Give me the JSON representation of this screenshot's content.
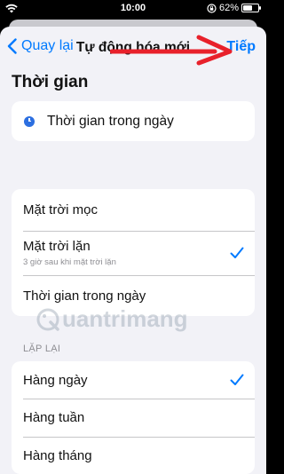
{
  "status_bar": {
    "time": "10:00",
    "battery_text": "62%",
    "battery_level": 0.62,
    "icons": [
      "wifi-icon",
      "screen-lock-icon",
      "battery-icon"
    ]
  },
  "nav": {
    "back_label": "Quay lại",
    "title": "Tự động hóa mới",
    "next_label": "Tiếp",
    "accent_color": "#007aff",
    "annotation_arrow_color": "#e8212b"
  },
  "section_title": "Thời gian",
  "time_of_day": {
    "label": "Thời gian trong ngày",
    "icon": "clock-icon"
  },
  "options": [
    {
      "label": "Mặt trời mọc",
      "subtitle": "",
      "checked": false
    },
    {
      "label": "Mặt trời lặn",
      "subtitle": "3 giờ sau khi mặt trời lặn",
      "checked": true
    },
    {
      "label": "Thời gian trong ngày",
      "subtitle": "",
      "checked": false
    }
  ],
  "repeat": {
    "header": "LẶP LẠI",
    "items": [
      {
        "label": "Hàng ngày",
        "checked": true
      },
      {
        "label": "Hàng tuần",
        "checked": false
      },
      {
        "label": "Hàng tháng",
        "checked": false
      }
    ]
  },
  "watermark": {
    "text": "uantrimang"
  }
}
